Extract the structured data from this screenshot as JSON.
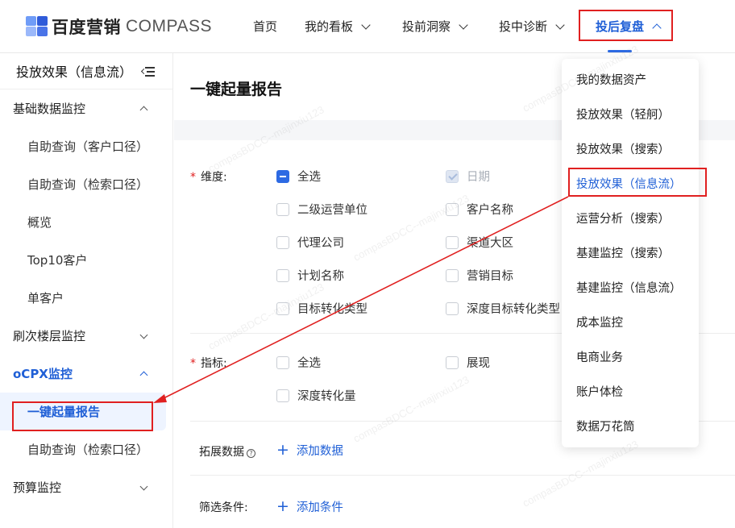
{
  "brand": {
    "cn": "百度营销",
    "en": "COMPASS"
  },
  "nav": {
    "home": "首页",
    "dashboard": "我的看板",
    "pre_insight": "投前洞察",
    "in_diagnosis": "投中诊断",
    "post_review": "投后复盘"
  },
  "sidebar": {
    "title": "投放效果（信息流）",
    "group_basic": "基础数据监控",
    "sub_self_customer": "自助查询（客户口径）",
    "sub_self_retrieval": "自助查询（检索口径）",
    "sub_overview": "概览",
    "sub_top10": "Top10客户",
    "sub_single": "单客户",
    "group_floor": "刷次楼层监控",
    "group_ocpx": "oCPX监控",
    "sub_one_key": "一键起量报告",
    "sub_self_retrieval2": "自助查询（检索口径）",
    "group_budget": "预算监控"
  },
  "main": {
    "title": "一键起量报告",
    "dimension_label": "维度:",
    "dim": {
      "all": "全选",
      "date": "日期",
      "l2_unit": "二级运营单位",
      "customer_name": "客户名称",
      "agency": "代理公司",
      "channel_region": "渠道大区",
      "plan_name": "计划名称",
      "marketing_goal": "营销目标",
      "target_conv": "目标转化类型",
      "deep_target_conv": "深度目标转化类型"
    },
    "metric_label": "指标:",
    "metric": {
      "all": "全选",
      "impression": "展现",
      "deep_conv": "深度转化量"
    },
    "extend_label": "拓展数据",
    "add_data": "添加数据",
    "filter_label": "筛选条件:",
    "add_filter": "添加条件"
  },
  "dropdown": [
    "我的数据资产",
    "投放效果（轻舸）",
    "投放效果（搜索）",
    "投放效果（信息流）",
    "运营分析（搜索）",
    "基建监控（搜索）",
    "基建监控（信息流）",
    "成本监控",
    "电商业务",
    "账户体检",
    "数据万花筒"
  ],
  "watermark": "compasBDCC--majinxiu123"
}
